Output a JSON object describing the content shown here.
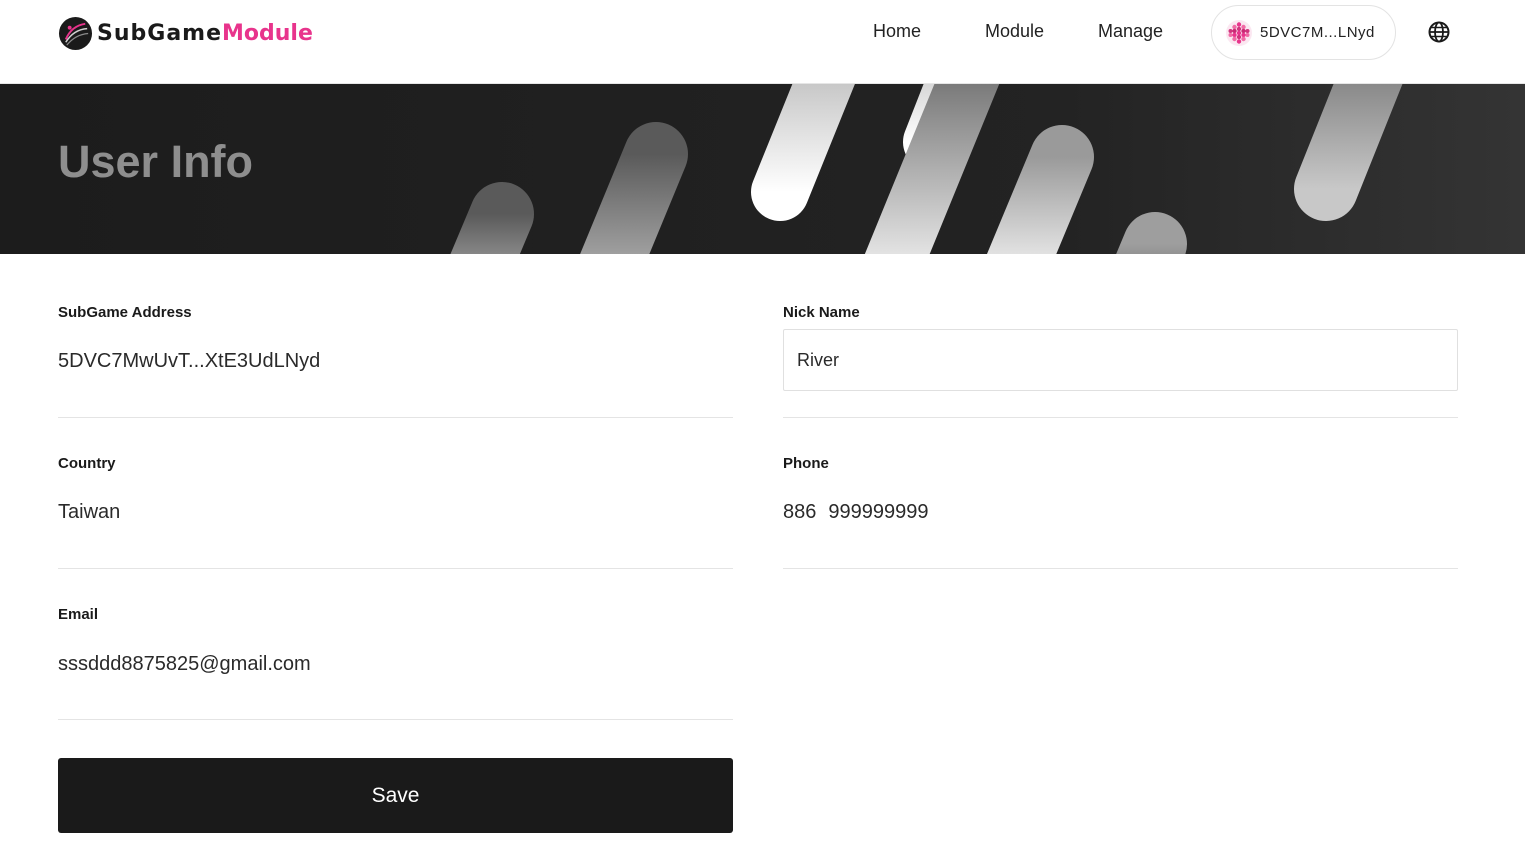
{
  "brand": {
    "name_part1": "SubGame",
    "name_part2": "Module",
    "accent_color": "#e8348c"
  },
  "nav": {
    "home": "Home",
    "module": "Module",
    "manage": "Manage"
  },
  "wallet": {
    "address_short": "5DVC7M...LNyd"
  },
  "icons": {
    "logo": "subgame-logo-icon",
    "wallet_avatar": "polkadot-identicon-icon",
    "language": "globe-icon"
  },
  "banner": {
    "title": "User Info"
  },
  "form": {
    "address": {
      "label": "SubGame Address",
      "value": "5DVC7MwUvT...XtE3UdLNyd"
    },
    "nickname": {
      "label": "Nick Name",
      "value": "River"
    },
    "country": {
      "label": "Country",
      "value": "Taiwan"
    },
    "phone": {
      "label": "Phone",
      "code": "886",
      "number": "999999999"
    },
    "email": {
      "label": "Email",
      "value": "sssddd8875825@gmail.com"
    },
    "save_label": "Save"
  }
}
